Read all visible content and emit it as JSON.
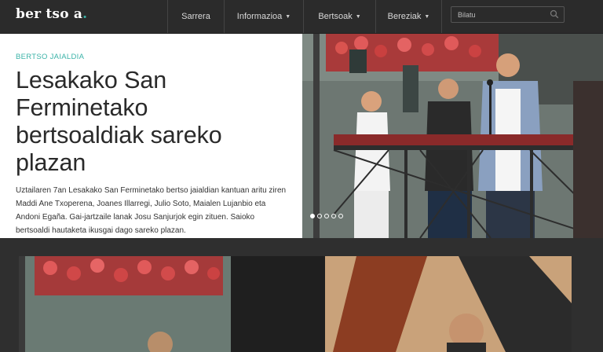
{
  "site": {
    "logo_text": "ber tso a",
    "logo_dot": "."
  },
  "nav": {
    "items": [
      {
        "label": "Sarrera",
        "dropdown": false
      },
      {
        "label": "Informazioa",
        "dropdown": true
      },
      {
        "label": "Bertsoak",
        "dropdown": true
      },
      {
        "label": "Bereziak",
        "dropdown": true
      }
    ]
  },
  "search": {
    "placeholder": "Bilatu"
  },
  "featured": {
    "category": "BERTSO JAIALDIA",
    "title": "Lesakako San Ferminetako bertsoaldiak sareko plazan",
    "summary": "Uztailaren 7an Lesakako San Ferminetako bertso jaialdian kantuan aritu ziren Maddi Ane Txoperena, Joanes Illarregi, Julio Soto, Maialen Lujanbio eta Andoni Egaña. Gai-jartzaile lanak Josu Sanjurjok egin zituen. Saioko bertsoaldi hautaketa ikusgai dago sareko plazan."
  },
  "slider": {
    "count": 5,
    "active": 1
  },
  "colors": {
    "accent": "#3bb3a8",
    "topbar": "#2b2b2b",
    "background": "#2f2f2f"
  },
  "icons": {
    "search": "search-icon",
    "caret": "caret-down-icon"
  }
}
